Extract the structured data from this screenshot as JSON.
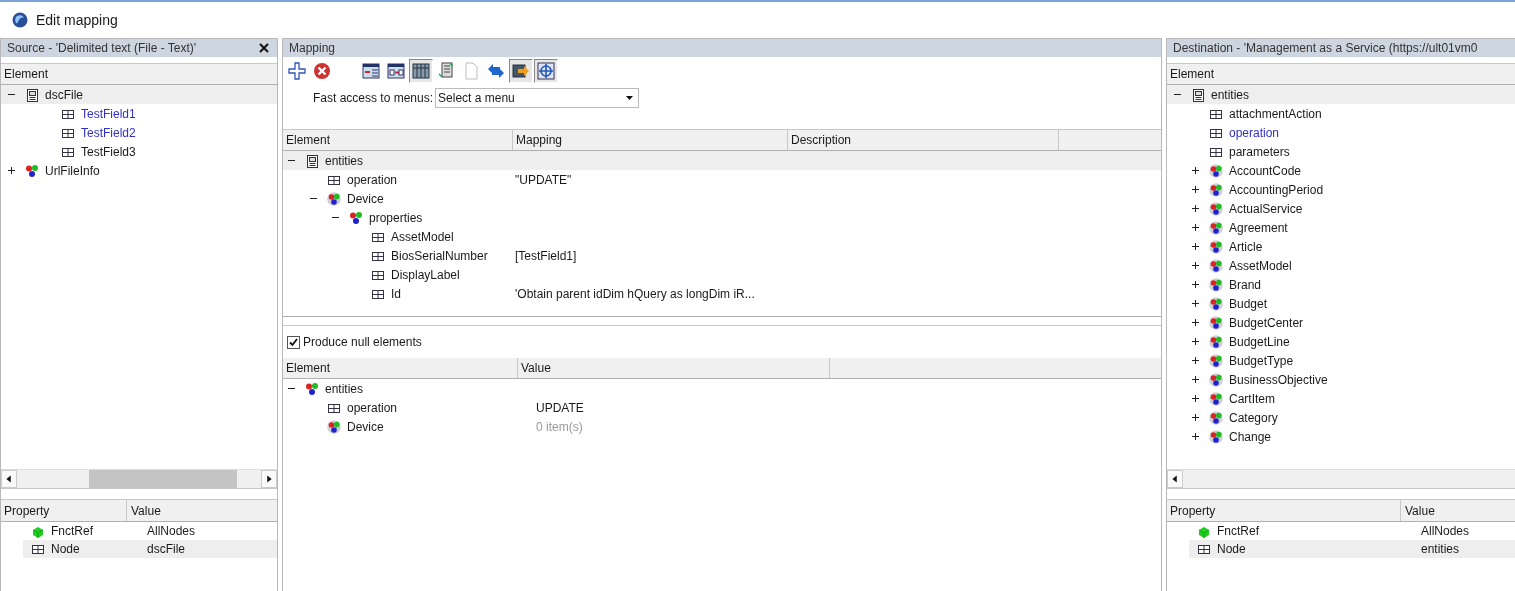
{
  "window": {
    "title": "Edit mapping"
  },
  "source": {
    "title": "Source - 'Delimited text (File - Text)'",
    "tree_header": "Element",
    "tree": [
      {
        "label": "dscFile",
        "kind": "document",
        "expanded": true,
        "selected": true,
        "mapped": false,
        "children": [
          {
            "label": "TestField1",
            "kind": "field",
            "selected": false,
            "mapped": true
          },
          {
            "label": "TestField2",
            "kind": "field",
            "selected": false,
            "mapped": true
          },
          {
            "label": "TestField3",
            "kind": "field",
            "selected": false,
            "mapped": false
          }
        ]
      },
      {
        "label": "UrlFileInfo",
        "kind": "object",
        "expanded": false,
        "selected": false,
        "mapped": false
      }
    ],
    "properties": {
      "columns": [
        "Property",
        "Value"
      ],
      "rows": [
        {
          "name": "FnctRef",
          "kind": "function",
          "value": "AllNodes",
          "selected": false
        },
        {
          "name": "Node",
          "kind": "field",
          "value": "dscFile",
          "selected": true
        }
      ]
    }
  },
  "mapping": {
    "title": "Mapping",
    "toolbar": [
      {
        "kind": "add",
        "pressed": false
      },
      {
        "kind": "delete",
        "pressed": false
      },
      {
        "kind": "insert-before",
        "pressed": false
      },
      {
        "kind": "insert-after",
        "pressed": false
      },
      {
        "kind": "grid",
        "pressed": true
      },
      {
        "kind": "tree-doc",
        "pressed": false
      },
      {
        "kind": "copy",
        "pressed": false
      },
      {
        "kind": "swap",
        "pressed": false
      },
      {
        "kind": "export",
        "pressed": true
      },
      {
        "kind": "target",
        "pressed": true
      }
    ],
    "menu_label": "Fast access to menus:",
    "menu_value": "Select a menu",
    "columns": [
      "Element",
      "Mapping",
      "Description"
    ],
    "tree": [
      {
        "label": "entities",
        "kind": "document",
        "expanded": true,
        "selected": true,
        "children": [
          {
            "label": "operation",
            "kind": "field",
            "mapping": "\"UPDATE\"",
            "selected": false
          },
          {
            "label": "Device",
            "kind": "collection",
            "expanded": true,
            "selected": false,
            "children": [
              {
                "label": "properties",
                "kind": "object",
                "expanded": true,
                "selected": false,
                "children": [
                  {
                    "label": "AssetModel",
                    "kind": "field",
                    "selected": false
                  },
                  {
                    "label": "BiosSerialNumber",
                    "kind": "field",
                    "mapping": "[TestField1]",
                    "selected": false
                  },
                  {
                    "label": "DisplayLabel",
                    "kind": "field",
                    "selected": false
                  },
                  {
                    "label": "Id",
                    "kind": "field",
                    "mapping": "'Obtain parent idDim hQuery as longDim iR...",
                    "selected": false
                  }
                ]
              }
            ]
          }
        ]
      }
    ],
    "produce_null": {
      "label": "Produce null elements",
      "checked": true
    },
    "preview": {
      "columns": [
        "Element",
        "Value"
      ],
      "tree": [
        {
          "label": "entities",
          "kind": "object",
          "expanded": true,
          "children": [
            {
              "label": "operation",
              "kind": "field",
              "value": "UPDATE",
              "greyed": false
            },
            {
              "label": "Device",
              "kind": "collection",
              "value": "0 item(s)",
              "greyed": true
            }
          ]
        }
      ]
    }
  },
  "destination": {
    "title": "Destination - 'Management as a Service (https://ult01vm0",
    "tree_header": "Element",
    "tree": [
      {
        "label": "entities",
        "kind": "document",
        "expanded": true,
        "selected": true,
        "mapped": false,
        "children": [
          {
            "label": "attachmentAction",
            "kind": "field",
            "selected": false,
            "mapped": false
          },
          {
            "label": "operation",
            "kind": "field",
            "selected": false,
            "mapped": true
          },
          {
            "label": "parameters",
            "kind": "field",
            "selected": false,
            "mapped": false
          },
          {
            "label": "AccountCode",
            "kind": "collection",
            "expanded": false,
            "selected": false,
            "mapped": false
          },
          {
            "label": "AccountingPeriod",
            "kind": "collection",
            "expanded": false,
            "selected": false,
            "mapped": false
          },
          {
            "label": "ActualService",
            "kind": "collection",
            "expanded": false,
            "selected": false,
            "mapped": false
          },
          {
            "label": "Agreement",
            "kind": "collection",
            "expanded": false,
            "selected": false,
            "mapped": false
          },
          {
            "label": "Article",
            "kind": "collection",
            "expanded": false,
            "selected": false,
            "mapped": false
          },
          {
            "label": "AssetModel",
            "kind": "collection",
            "expanded": false,
            "selected": false,
            "mapped": false
          },
          {
            "label": "Brand",
            "kind": "collection",
            "expanded": false,
            "selected": false,
            "mapped": false
          },
          {
            "label": "Budget",
            "kind": "collection",
            "expanded": false,
            "selected": false,
            "mapped": false
          },
          {
            "label": "BudgetCenter",
            "kind": "collection",
            "expanded": false,
            "selected": false,
            "mapped": false
          },
          {
            "label": "BudgetLine",
            "kind": "collection",
            "expanded": false,
            "selected": false,
            "mapped": false
          },
          {
            "label": "BudgetType",
            "kind": "collection",
            "expanded": false,
            "selected": false,
            "mapped": false
          },
          {
            "label": "BusinessObjective",
            "kind": "collection",
            "expanded": false,
            "selected": false,
            "mapped": false
          },
          {
            "label": "CartItem",
            "kind": "collection",
            "expanded": false,
            "selected": false,
            "mapped": false
          },
          {
            "label": "Category",
            "kind": "collection",
            "expanded": false,
            "selected": false,
            "mapped": false
          },
          {
            "label": "Change",
            "kind": "collection",
            "expanded": false,
            "selected": false,
            "mapped": false
          }
        ]
      }
    ],
    "properties": {
      "columns": [
        "Property",
        "Value"
      ],
      "rows": [
        {
          "name": "FnctRef",
          "kind": "function",
          "value": "AllNodes",
          "selected": false
        },
        {
          "name": "Node",
          "kind": "field",
          "value": "entities",
          "selected": true
        }
      ]
    }
  }
}
